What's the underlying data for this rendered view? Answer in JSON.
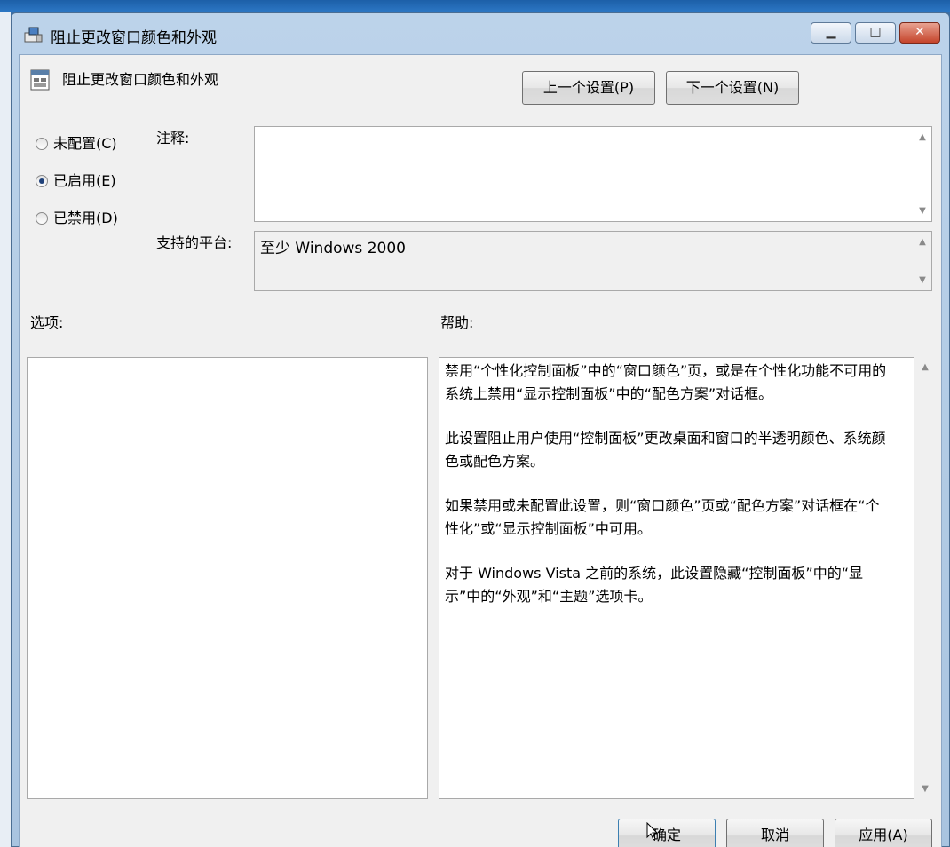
{
  "window": {
    "title": "阻止更改窗口颜色和外观",
    "controls": {
      "minimize": "▁",
      "maximize": "□",
      "close": "✕"
    }
  },
  "header": {
    "title": "阻止更改窗口颜色和外观",
    "prev_label": "上一个设置(P)",
    "next_label": "下一个设置(N)"
  },
  "state": {
    "options": [
      {
        "label": "未配置(C)",
        "selected": false
      },
      {
        "label": "已启用(E)",
        "selected": true
      },
      {
        "label": "已禁用(D)",
        "selected": false
      }
    ]
  },
  "comment": {
    "label": "注释:",
    "value": ""
  },
  "platform": {
    "label": "支持的平台:",
    "value": "至少 Windows 2000"
  },
  "options_label": "选项:",
  "help": {
    "label": "帮助:",
    "paragraphs": [
      "禁用“个性化控制面板”中的“窗口颜色”页，或是在个性化功能不可用的系统上禁用“显示控制面板”中的“配色方案”对话框。",
      "此设置阻止用户使用“控制面板”更改桌面和窗口的半透明颜色、系统颜色或配色方案。",
      "如果禁用或未配置此设置，则“窗口颜色”页或“配色方案”对话框在“个性化”或“显示控制面板”中可用。",
      "对于 Windows Vista 之前的系统，此设置隐藏“控制面板”中的“显示”中的“外观”和“主题”选项卡。"
    ]
  },
  "footer": {
    "ok_label": "确定",
    "cancel_label": "取消",
    "apply_label": "应用(A)"
  },
  "colors": {
    "accent": "#3c7fb1",
    "close_red": "#c5442b",
    "client_bg": "#f0f0f0"
  }
}
